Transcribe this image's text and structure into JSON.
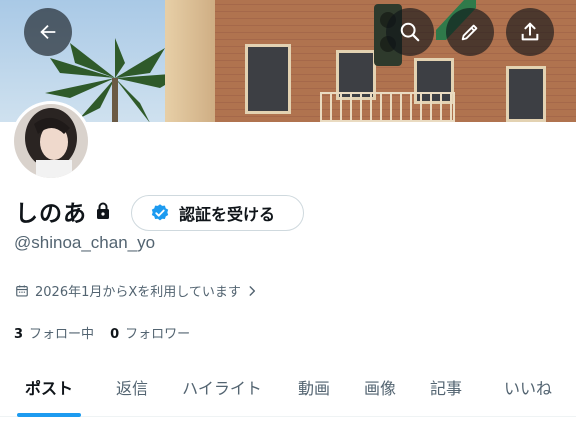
{
  "header": {
    "back_icon": "arrow-left-icon",
    "search_icon": "search-icon",
    "edit_icon": "pencil-icon",
    "share_icon": "upload-icon"
  },
  "profile": {
    "display_name": "しのあ",
    "protected_icon": "lock-icon",
    "handle": "@shinoa_chan_yo",
    "verify_button_label": "認証を受ける",
    "verify_icon": "verified-badge-icon",
    "joined_icon": "calendar-icon",
    "joined_text": "2026年1月からXを利用しています",
    "joined_chevron": "chevron-right-icon",
    "following_count": "3",
    "following_label": "フォロー中",
    "followers_count": "0",
    "followers_label": "フォロワー"
  },
  "tabs": [
    {
      "label": "ポスト",
      "active": true
    },
    {
      "label": "返信"
    },
    {
      "label": "ハイライト"
    },
    {
      "label": "動画"
    },
    {
      "label": "画像"
    },
    {
      "label": "記事"
    },
    {
      "label": "いいね"
    }
  ],
  "colors": {
    "accent": "#1d9bf0",
    "text_primary": "#0f1419",
    "text_secondary": "#536471",
    "border": "#cfd9de"
  }
}
